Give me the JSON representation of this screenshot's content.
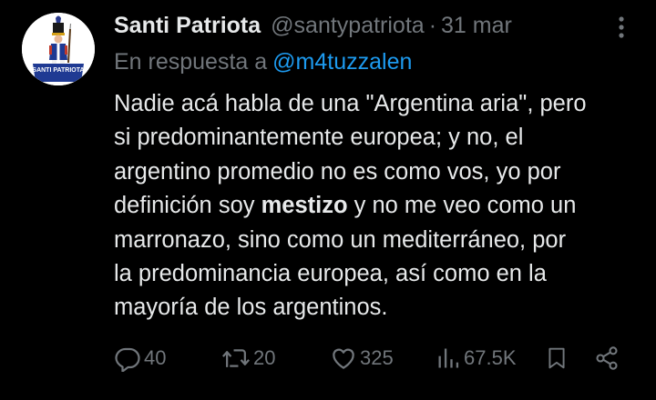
{
  "tweet": {
    "author": {
      "name": "Santi Patriota",
      "handle": "@santypatriota",
      "avatar_icon": "soldier-avatar",
      "avatar_text": "SANTI PATRIOTA"
    },
    "separator": "·",
    "date": "31 mar",
    "reply": {
      "label": "En respuesta a",
      "mention": "@m4tuzzalen"
    },
    "body_lines": [
      "Nadie acá habla de una \"Argentina aria\", pero",
      "si predominantemente europea; y no, el",
      "argentino promedio no es como vos, yo por",
      {
        "before": "definición soy ",
        "bold": "mestizo",
        "after": " y no me veo como un"
      },
      "marronazo, sino como un mediterráneo, por",
      "la predominancia europea, así como en la",
      "mayoría de los argentinos."
    ],
    "actions": {
      "replies": "40",
      "reposts": "20",
      "likes": "325",
      "views": "67.5K"
    }
  },
  "colors": {
    "background": "#000000",
    "text_primary": "#e7e9ea",
    "text_secondary": "#71767b",
    "accent": "#1d9bf0"
  },
  "icons": [
    "more-icon",
    "reply-icon",
    "repost-icon",
    "like-icon",
    "views-icon",
    "bookmark-icon",
    "share-icon"
  ]
}
